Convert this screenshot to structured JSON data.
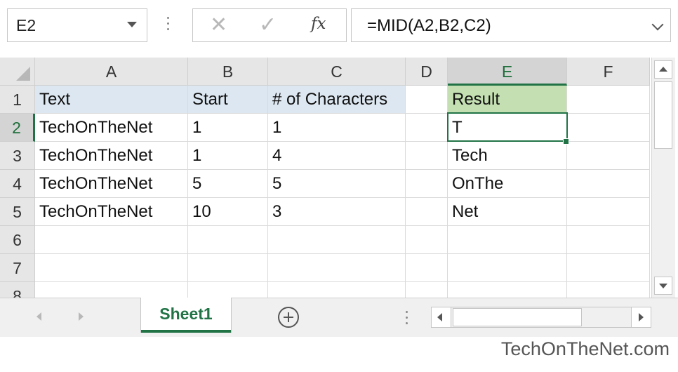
{
  "formula_bar": {
    "name_box": "E2",
    "fx_label": "fx",
    "formula": "=MID(A2,B2,C2)"
  },
  "grid": {
    "columns": [
      "A",
      "B",
      "C",
      "D",
      "E",
      "F"
    ],
    "rows": [
      "1",
      "2",
      "3",
      "4",
      "5",
      "6",
      "7",
      "8"
    ],
    "cells": [
      [
        "Text",
        "Start",
        "# of Characters",
        "",
        "Result",
        ""
      ],
      [
        "TechOnTheNet",
        "1",
        "1",
        "",
        "T",
        ""
      ],
      [
        "TechOnTheNet",
        "1",
        "4",
        "",
        "Tech",
        ""
      ],
      [
        "TechOnTheNet",
        "5",
        "5",
        "",
        "OnThe",
        ""
      ],
      [
        "TechOnTheNet",
        "10",
        "3",
        "",
        "Net",
        ""
      ],
      [
        "",
        "",
        "",
        "",
        "",
        ""
      ],
      [
        "",
        "",
        "",
        "",
        "",
        ""
      ],
      [
        "",
        "",
        "",
        "",
        "",
        ""
      ]
    ],
    "selected_cell": "E2"
  },
  "sheet_tabs": {
    "active": "Sheet1"
  },
  "watermark": "TechOnTheNet.com",
  "colors": {
    "accent": "#217346",
    "header_blue": "#dde7f1",
    "header_green": "#c4e0b2"
  }
}
